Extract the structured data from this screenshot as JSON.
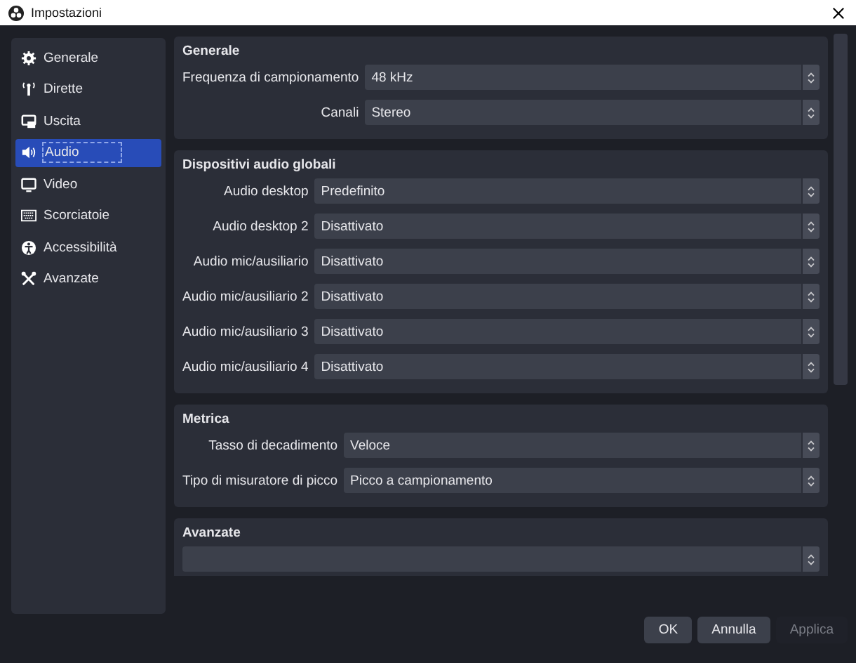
{
  "window": {
    "title": "Impostazioni"
  },
  "sidebar": {
    "items": [
      {
        "label": "Generale",
        "selected": false
      },
      {
        "label": "Dirette",
        "selected": false
      },
      {
        "label": "Uscita",
        "selected": false
      },
      {
        "label": "Audio",
        "selected": true
      },
      {
        "label": "Video",
        "selected": false
      },
      {
        "label": "Scorciatoie",
        "selected": false
      },
      {
        "label": "Accessibilità",
        "selected": false
      },
      {
        "label": "Avanzate",
        "selected": false
      }
    ]
  },
  "sections": [
    {
      "title": "Generale",
      "rows": [
        {
          "label": "Frequenza di campionamento",
          "value": "48 kHz"
        },
        {
          "label": "Canali",
          "value": "Stereo"
        }
      ]
    },
    {
      "title": "Dispositivi audio globali",
      "rows": [
        {
          "label": "Audio desktop",
          "value": "Predefinito"
        },
        {
          "label": "Audio desktop 2",
          "value": "Disattivato"
        },
        {
          "label": "Audio mic/ausiliario",
          "value": "Disattivato"
        },
        {
          "label": "Audio mic/ausiliario 2",
          "value": "Disattivato"
        },
        {
          "label": "Audio mic/ausiliario 3",
          "value": "Disattivato"
        },
        {
          "label": "Audio mic/ausiliario 4",
          "value": "Disattivato"
        }
      ]
    },
    {
      "title": "Metrica",
      "rows": [
        {
          "label": "Tasso di decadimento",
          "value": "Veloce"
        },
        {
          "label": "Tipo di misuratore di picco",
          "value": "Picco a campionamento"
        }
      ]
    },
    {
      "title": "Avanzate"
    }
  ],
  "buttons": [
    {
      "label": "OK",
      "disabled": false
    },
    {
      "label": "Annulla",
      "disabled": false
    },
    {
      "label": "Applica",
      "disabled": true
    }
  ]
}
